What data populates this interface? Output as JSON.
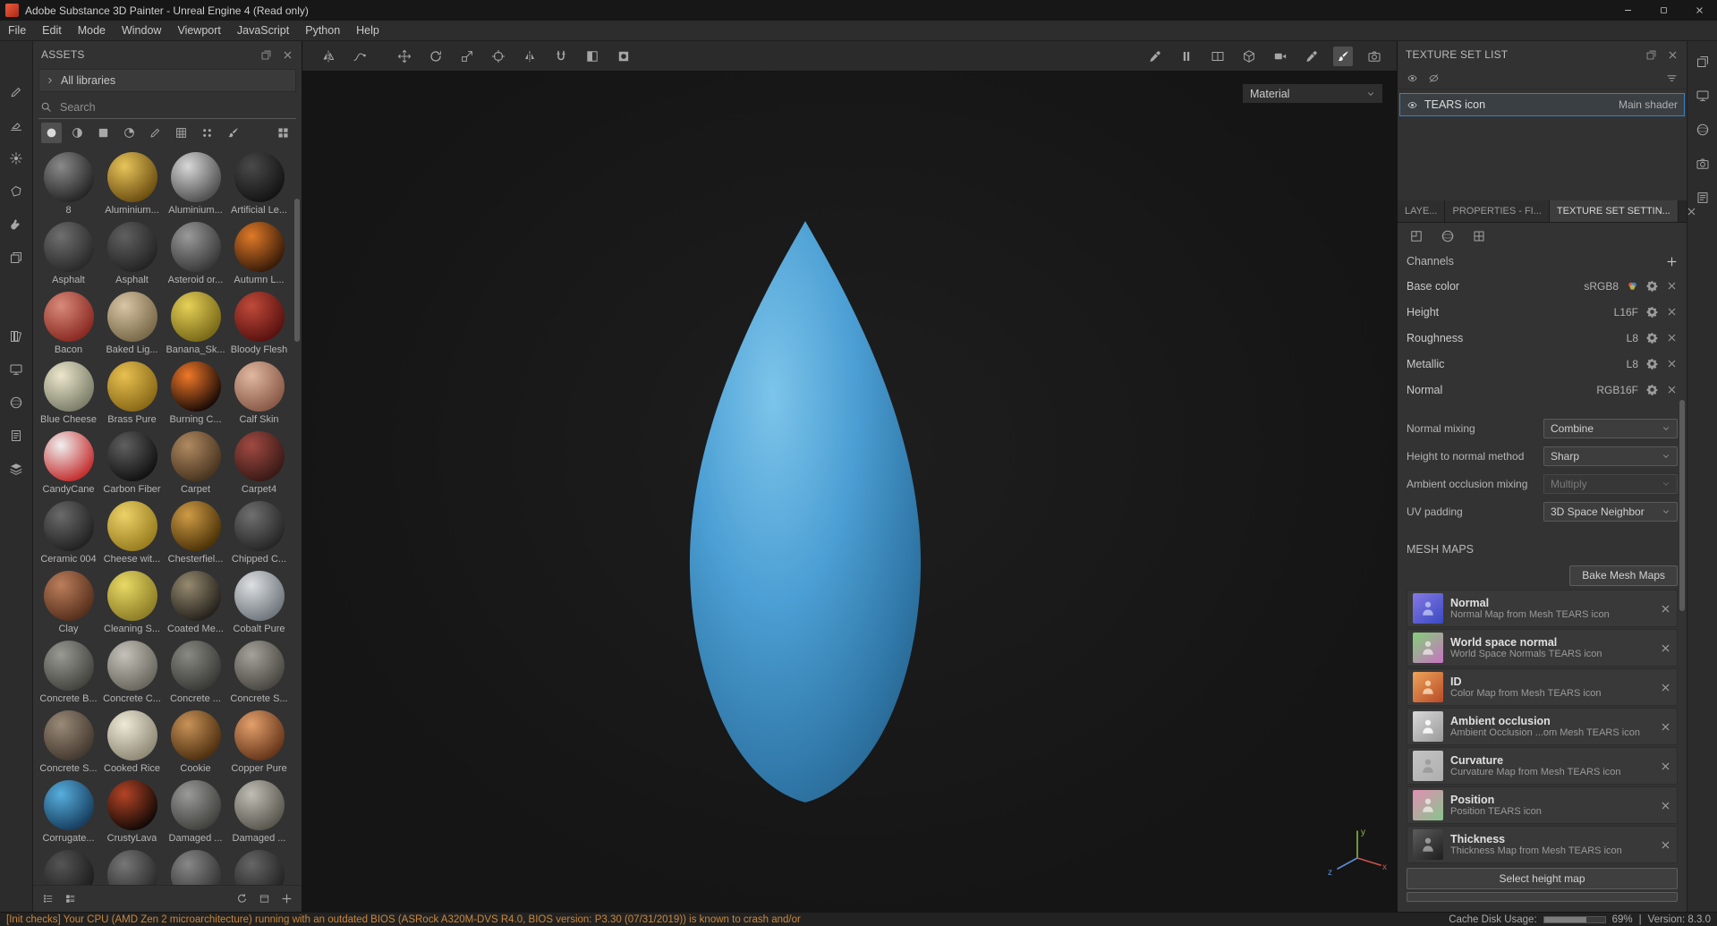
{
  "window": {
    "title": "Adobe Substance 3D Painter - Unreal Engine 4 (Read only)",
    "controls": [
      "minimize",
      "maximize",
      "close"
    ]
  },
  "menubar": {
    "items": [
      "File",
      "Edit",
      "Mode",
      "Window",
      "Viewport",
      "JavaScript",
      "Python",
      "Help"
    ]
  },
  "left_toolbar": {
    "tools_top": [
      "pencil",
      "eraser",
      "projection",
      "polygon-fill",
      "smudge",
      "clone"
    ],
    "tools_bottom": [
      "shelf",
      "monitor",
      "sphere",
      "doc",
      "layers"
    ]
  },
  "assets": {
    "title": "ASSETS",
    "header_icons": [
      "dock",
      "close"
    ],
    "library": "All libraries",
    "search_placeholder": "Search",
    "filters": [
      {
        "icon": "circle",
        "active": true
      },
      {
        "icon": "half-circle",
        "active": false
      },
      {
        "icon": "square",
        "active": false
      },
      {
        "icon": "quarter-circle",
        "active": false
      },
      {
        "icon": "pencil",
        "active": false
      },
      {
        "icon": "grid",
        "active": false
      },
      {
        "icon": "dots",
        "active": false
      },
      {
        "icon": "brush",
        "active": false
      }
    ],
    "footer_icons_left": [
      "list-small",
      "list-large"
    ],
    "footer_icons_right": [
      "refresh",
      "panel",
      "plus"
    ],
    "materials": [
      {
        "name": "8",
        "c1": "#8a8a8a",
        "c2": "#262626"
      },
      {
        "name": "Aluminium...",
        "c1": "#e8c55a",
        "c2": "#6e5012"
      },
      {
        "name": "Aluminium...",
        "c1": "#d8d8d8",
        "c2": "#515151"
      },
      {
        "name": "Artificial Le...",
        "c1": "#4a4a4a",
        "c2": "#141414"
      },
      {
        "name": "Asphalt",
        "c1": "#6f6f6f",
        "c2": "#2a2a2a"
      },
      {
        "name": "Asphalt",
        "c1": "#606060",
        "c2": "#242424"
      },
      {
        "name": "Asteroid or...",
        "c1": "#9a9a9a",
        "c2": "#3a3a3a"
      },
      {
        "name": "Autumn L...",
        "c1": "#e07a28",
        "c2": "#3a1c08"
      },
      {
        "name": "Bacon",
        "c1": "#d98a7a",
        "c2": "#8a2a22"
      },
      {
        "name": "Baked Lig...",
        "c1": "#d8c5a5",
        "c2": "#7a6a4a"
      },
      {
        "name": "Banana_Sk...",
        "c1": "#e6d158",
        "c2": "#7a6a18"
      },
      {
        "name": "Bloody Flesh",
        "c1": "#c04a3a",
        "c2": "#5a1210"
      },
      {
        "name": "Blue Cheese",
        "c1": "#ece6cc",
        "c2": "#7d7f6a"
      },
      {
        "name": "Brass Pure",
        "c1": "#e8c050",
        "c2": "#8a6a18"
      },
      {
        "name": "Burning C...",
        "c1": "#f07828",
        "c2": "#1c0c06"
      },
      {
        "name": "Calf Skin",
        "c1": "#e0b8a0",
        "c2": "#8a5a48"
      },
      {
        "name": "CandyCane",
        "c1": "#f0f0f0",
        "c2": "#c43030"
      },
      {
        "name": "Carbon Fiber",
        "c1": "#606060",
        "c2": "#121212"
      },
      {
        "name": "Carpet",
        "c1": "#b08a62",
        "c2": "#4a3520"
      },
      {
        "name": "Carpet4",
        "c1": "#a04a42",
        "c2": "#3a1a16"
      },
      {
        "name": "Ceramic 004",
        "c1": "#6a6a6a",
        "c2": "#222222"
      },
      {
        "name": "Cheese wit...",
        "c1": "#ecd268",
        "c2": "#9a7e20"
      },
      {
        "name": "Chesterfiel...",
        "c1": "#cf9c46",
        "c2": "#4e3408"
      },
      {
        "name": "Chipped C...",
        "c1": "#707070",
        "c2": "#262626"
      },
      {
        "name": "Clay",
        "c1": "#bc7e5c",
        "c2": "#57301c"
      },
      {
        "name": "Cleaning S...",
        "c1": "#e8da66",
        "c2": "#8e7e26"
      },
      {
        "name": "Coated Me...",
        "c1": "#968a70",
        "c2": "#26221c"
      },
      {
        "name": "Cobalt Pure",
        "c1": "#dde0e3",
        "c2": "#70777d"
      },
      {
        "name": "Concrete B...",
        "c1": "#9a9a95",
        "c2": "#45453f"
      },
      {
        "name": "Concrete C...",
        "c1": "#c5c2ba",
        "c2": "#6a675f"
      },
      {
        "name": "Concrete ...",
        "c1": "#8a8a85",
        "c2": "#3a3a36"
      },
      {
        "name": "Concrete S...",
        "c1": "#a5a29a",
        "c2": "#4a4842"
      },
      {
        "name": "Concrete S...",
        "c1": "#9a8a78",
        "c2": "#453a30"
      },
      {
        "name": "Cooked Rice",
        "c1": "#efe9d8",
        "c2": "#8f8a76"
      },
      {
        "name": "Cookie",
        "c1": "#c89258",
        "c2": "#4f3010"
      },
      {
        "name": "Copper Pure",
        "c1": "#e3a06c",
        "c2": "#67361a"
      },
      {
        "name": "Corrugate...",
        "c1": "#57aede",
        "c2": "#173f60"
      },
      {
        "name": "CrustyLava",
        "c1": "#b44426",
        "c2": "#140a06"
      },
      {
        "name": "Damaged ...",
        "c1": "#9a9a9a",
        "c2": "#42423e"
      },
      {
        "name": "Damaged ...",
        "c1": "#c0bdb5",
        "c2": "#5a574f"
      },
      {
        "name": "",
        "c1": "#555555",
        "c2": "#1c1c1c"
      },
      {
        "name": "",
        "c1": "#777777",
        "c2": "#2a2a2a"
      },
      {
        "name": "",
        "c1": "#888888",
        "c2": "#333333"
      },
      {
        "name": "",
        "c1": "#666666",
        "c2": "#222222"
      }
    ]
  },
  "viewport_toolbar": {
    "left_tools": [
      "symmetry",
      "lazy-mouse"
    ],
    "transform_tools": [
      "move",
      "rotate",
      "scale",
      "manipulator",
      "mirror",
      "magnet",
      "quick-mask",
      "stencil"
    ],
    "right_tools": [
      {
        "icon": "color-picker",
        "active": false
      },
      {
        "icon": "pause",
        "active": false
      },
      {
        "icon": "split-view",
        "active": false
      },
      {
        "icon": "cube",
        "active": false
      },
      {
        "icon": "video-camera",
        "active": false
      },
      {
        "icon": "dropper",
        "active": false
      },
      {
        "icon": "brush",
        "active": true
      },
      {
        "icon": "camera",
        "active": false
      }
    ]
  },
  "viewport": {
    "shader_dropdown": "Material",
    "model": {
      "highlight": "#7cc4ea",
      "mid": "#4c9fd4",
      "dark": "#2f76a6",
      "edge": "#245d85"
    },
    "gizmo": {
      "x_label": "x",
      "y_label": "y",
      "z_label": "z",
      "x_color": "#cf5348",
      "y_color": "#88b83e",
      "z_color": "#5b8fd4"
    }
  },
  "texture_set_list": {
    "title": "TEXTURE SET LIST",
    "header_icons": [
      "dock",
      "close"
    ],
    "toolbar_icons_left": [
      "eye",
      "eye-off"
    ],
    "toolbar_icons_right": [
      "filter-menu"
    ],
    "row": {
      "name": "TEARS icon",
      "shader": "Main shader"
    }
  },
  "tabs": {
    "items": [
      {
        "label": "LAYE...",
        "active": false
      },
      {
        "label": "PROPERTIES - FI...",
        "active": false
      },
      {
        "label": "TEXTURE SET SETTIN...",
        "active": true
      }
    ]
  },
  "texture_set_settings": {
    "section_icons": [
      "resolution",
      "sphere",
      "uv-grid"
    ],
    "channels": {
      "title": "Channels",
      "rows": [
        {
          "name": "Base color",
          "format": "sRGB8",
          "extra_icon": true
        },
        {
          "name": "Height",
          "format": "L16F",
          "extra_icon": false
        },
        {
          "name": "Roughness",
          "format": "L8",
          "extra_icon": false
        },
        {
          "name": "Metallic",
          "format": "L8",
          "extra_icon": false
        },
        {
          "name": "Normal",
          "format": "RGB16F",
          "extra_icon": false
        }
      ]
    },
    "params": [
      {
        "label": "Normal mixing",
        "value": "Combine",
        "disabled": false
      },
      {
        "label": "Height to normal method",
        "value": "Sharp",
        "disabled": false
      },
      {
        "label": "Ambient occlusion mixing",
        "value": "Multiply",
        "disabled": true
      },
      {
        "label": "UV padding",
        "value": "3D Space Neighbor",
        "disabled": false
      }
    ],
    "mesh_maps": {
      "title": "MESH MAPS",
      "bake_button": "Bake Mesh Maps",
      "rows": [
        {
          "name": "Normal",
          "desc": "Normal Map from Mesh TEARS icon",
          "c1": "#8579e4",
          "c2": "#3a49c0",
          "fg": "rgba(215,225,255,0.65)"
        },
        {
          "name": "World space normal",
          "desc": "World Space Normals TEARS icon",
          "c1": "#82d077",
          "c2": "#c873c2",
          "fg": "rgba(255,255,255,0.6)"
        },
        {
          "name": "ID",
          "desc": "Color Map from Mesh TEARS icon",
          "c1": "#eda458",
          "c2": "#b84a28",
          "fg": "rgba(255,240,210,0.7)"
        },
        {
          "name": "Ambient occlusion",
          "desc": "Ambient Occlusion ...om Mesh TEARS icon",
          "c1": "#d8d8d8",
          "c2": "#9a9a9a",
          "fg": "rgba(255,255,255,0.85)"
        },
        {
          "name": "Curvature",
          "desc": "Curvature Map from Mesh TEARS icon",
          "c1": "#c4c4c4",
          "c2": "#aeaeae",
          "fg": "rgba(130,130,130,0.5)"
        },
        {
          "name": "Position",
          "desc": "Position TEARS icon",
          "c1": "#e28fb4",
          "c2": "#87c48c",
          "fg": "rgba(255,255,255,0.6)"
        },
        {
          "name": "Thickness",
          "desc": "Thickness Map from Mesh TEARS icon",
          "c1": "#5c5c5c",
          "c2": "#1e1e1e",
          "fg": "rgba(235,235,235,0.5)"
        }
      ],
      "select_height_button": "Select height map"
    }
  },
  "right_strip": {
    "icons": [
      "dock",
      "monitor",
      "sphere",
      "camera",
      "note"
    ]
  },
  "statusbar": {
    "warning": "[Init checks] Your CPU (AMD Zen 2 microarchitecture) running with an outdated BIOS (ASRock A320M-DVS R4.0, BIOS version: P3.30 (07/31/2019)) is known to crash and/or",
    "cache_label": "Cache Disk Usage:",
    "cache_percent": "69%",
    "separator": "|",
    "version": "Version: 8.3.0"
  }
}
